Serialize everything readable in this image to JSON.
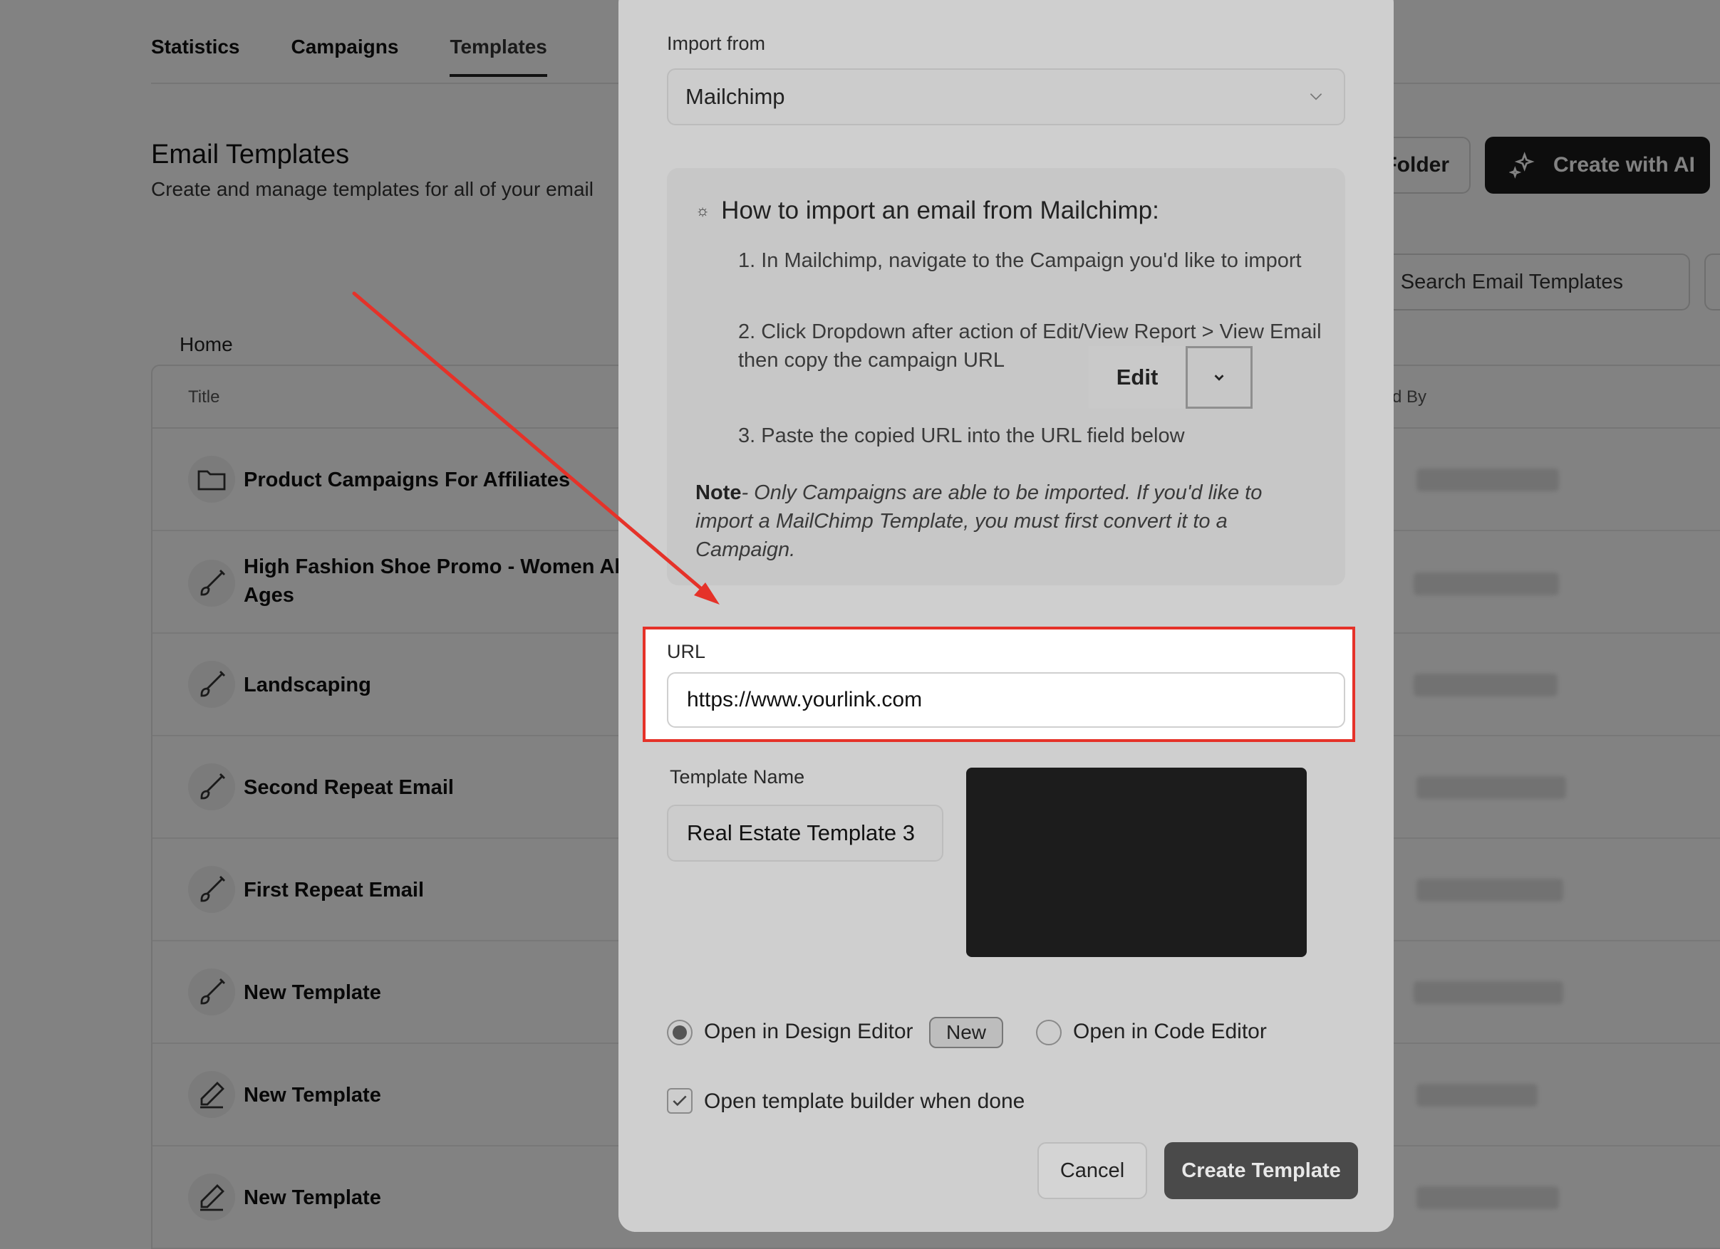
{
  "nav": {
    "tabs": [
      "Statistics",
      "Campaigns",
      "Templates"
    ],
    "active_tab": "Templates"
  },
  "page": {
    "title": "Email Templates",
    "subtitle": "Create and manage templates for all of your email",
    "folder_button": "Folder",
    "ai_button": "Create with AI",
    "search_placeholder": "Search Email Templates",
    "breadcrumb": "Home"
  },
  "table": {
    "columns": [
      "Title",
      "ted By"
    ],
    "rows": [
      {
        "title": "Product Campaigns For Affiliates",
        "icon": "folder-icon"
      },
      {
        "title": "High Fashion Shoe Promo - Women All Ages",
        "icon": "brush-icon"
      },
      {
        "title": "Landscaping",
        "icon": "brush-icon"
      },
      {
        "title": "Second Repeat Email",
        "icon": "brush-icon"
      },
      {
        "title": "First Repeat Email",
        "icon": "brush-icon"
      },
      {
        "title": "New Template",
        "icon": "brush-icon"
      },
      {
        "title": "New Template",
        "icon": "pen-icon"
      },
      {
        "title": "New Template",
        "icon": "pen-icon"
      }
    ]
  },
  "modal": {
    "import_label": "Import from",
    "import_value": "Mailchimp",
    "howto_title": "How to import an email from Mailchimp:",
    "step1": "1. In Mailchimp, navigate to the Campaign you'd like to import",
    "step2": "2. Click Dropdown after action of Edit/View Report > View Email then copy the campaign URL",
    "step2_pill": "Edit",
    "step3": "3. Paste the copied URL into the URL field below",
    "note_label": "Note",
    "note_text": "- Only Campaigns are able to be imported. If you'd like to import a MailChimp Template, you must first convert it to a Campaign.",
    "url_label": "URL",
    "url_value": "https://www.yourlink.com",
    "template_name_label": "Template Name",
    "template_name_value": "Real Estate Template 3",
    "option_design": "Open in Design Editor",
    "option_design_badge": "New",
    "option_code": "Open in Code Editor",
    "open_builder_checkbox": "Open template builder when done",
    "cancel_button": "Cancel",
    "create_button": "Create Template"
  },
  "colors": {
    "highlight": "#e53229",
    "overlay": "rgba(0,0,0,0.49)",
    "primary_dark": "#1b1b1b"
  }
}
